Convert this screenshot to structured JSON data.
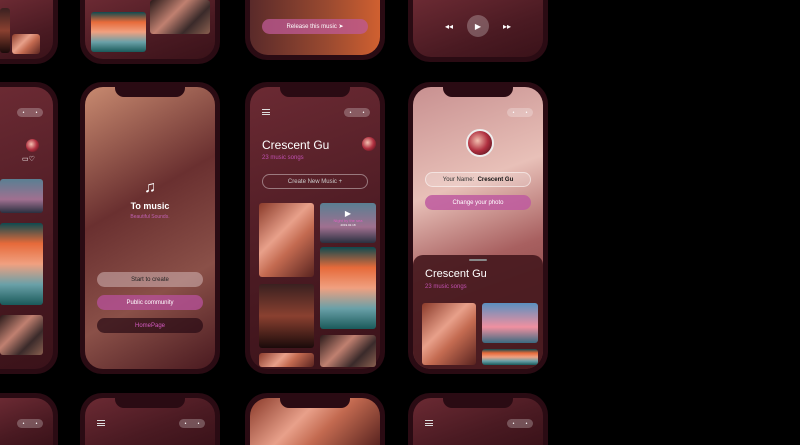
{
  "splash": {
    "title": "To music",
    "subtitle": "Beautiful Sounds.",
    "buttons": [
      "Start to create",
      "Public community",
      "HomePage"
    ]
  },
  "profile": {
    "name": "Crescent Gu",
    "songs": "23 music songs",
    "create_button": "Create New Music +",
    "card_title": "Night by the sea",
    "card_date": "2019.02.18"
  },
  "settings": {
    "name_label": "Your Name:",
    "name_value": "Crescent Gu",
    "change_photo": "Change your photo",
    "sheet_name": "Crescent Gu",
    "sheet_songs": "23 music songs"
  },
  "release": {
    "button": "Release this music"
  },
  "player": {
    "controls": [
      "rewind",
      "play",
      "fast-forward"
    ]
  },
  "colors": {
    "background": "#000000",
    "frame": "#2a0b13",
    "accent": "#b04a8a",
    "accent_text": "#d45ac0"
  }
}
